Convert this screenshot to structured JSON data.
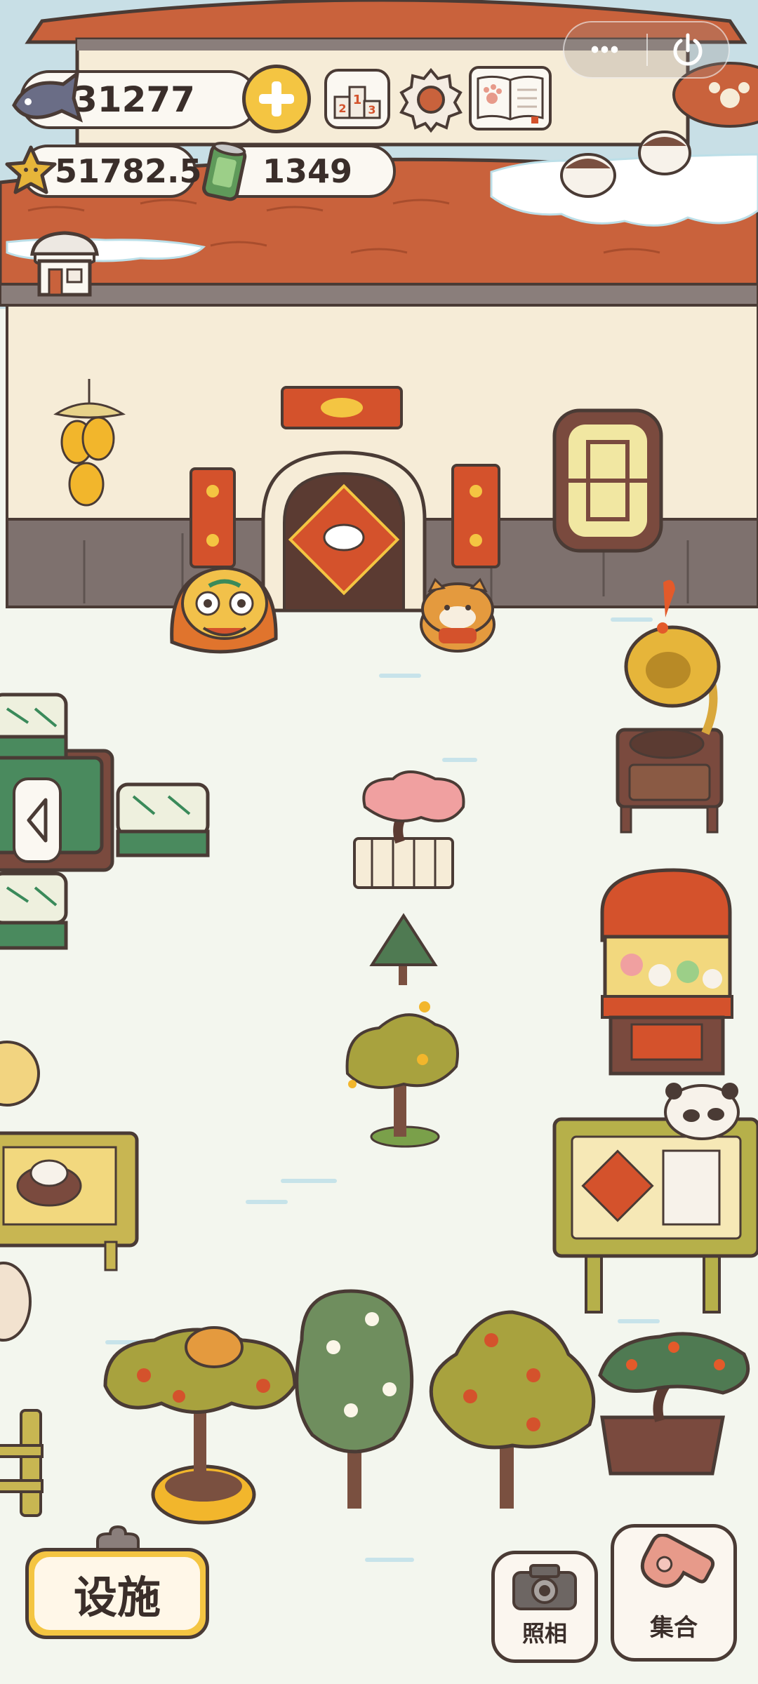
{
  "hud": {
    "fish": "31277",
    "stars": "51782.5",
    "cans": "1349",
    "icons": {
      "fish": "fish-icon",
      "add": "plus-icon",
      "ranking": "podium-icon",
      "settings": "gear-icon",
      "book": "paw-book-icon",
      "star": "star-icon",
      "can": "can-icon",
      "shop": "shop-icon"
    }
  },
  "miniprogram": {
    "more": "•••",
    "close_icon": "power-icon"
  },
  "bottom": {
    "facilities": "设施",
    "photo": "照相",
    "gather": "集合"
  },
  "colors": {
    "roof": "#c9623c",
    "wall": "#f6ecd7",
    "ground": "#f3f6ee",
    "outline": "#4a3b35",
    "accent": "#f4c542"
  }
}
